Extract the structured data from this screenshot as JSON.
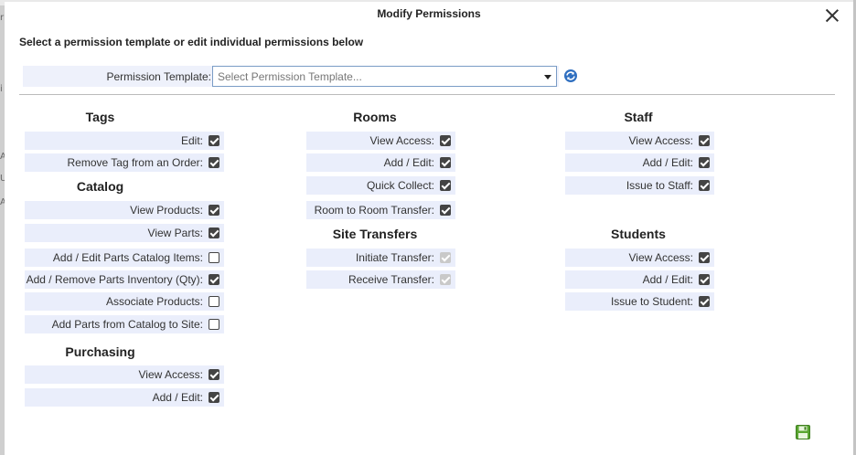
{
  "background": {
    "edge_chars": [
      "r",
      "i",
      "A",
      "U",
      "A"
    ]
  },
  "dialog": {
    "title": "Modify Permissions",
    "instructions": "Select a permission template or edit individual permissions below",
    "template": {
      "label": "Permission Template:",
      "placeholder": "Select Permission Template..."
    },
    "icons": {
      "close": "close-icon",
      "refresh": "refresh-icon",
      "save": "save-icon"
    },
    "colors": {
      "row_bg": "#eaeefb",
      "select_border": "#7a9cc6",
      "refresh_blue": "#2f6fc0",
      "save_green": "#5aa631"
    }
  },
  "sections": {
    "tags": {
      "title": "Tags",
      "items": [
        {
          "label": "Edit:",
          "checked": true
        },
        {
          "label": "Remove Tag from an Order:",
          "checked": true
        }
      ]
    },
    "catalog": {
      "title": "Catalog",
      "items": [
        {
          "label": "View Products:",
          "checked": true
        },
        {
          "label": "View Parts:",
          "checked": true
        },
        {
          "label": "Add / Edit Parts Catalog Items:",
          "checked": false
        },
        {
          "label": "Add / Remove Parts Inventory (Qty):",
          "checked": true
        },
        {
          "label": "Associate Products:",
          "checked": false
        },
        {
          "label": "Add Parts from Catalog to Site:",
          "checked": false
        }
      ]
    },
    "purchasing": {
      "title": "Purchasing",
      "items": [
        {
          "label": "View Access:",
          "checked": true
        },
        {
          "label": "Add / Edit:",
          "checked": true
        }
      ]
    },
    "rooms": {
      "title": "Rooms",
      "items": [
        {
          "label": "View Access:",
          "checked": true
        },
        {
          "label": "Add / Edit:",
          "checked": true
        },
        {
          "label": "Quick Collect:",
          "checked": true
        },
        {
          "label": "Room to Room Transfer:",
          "checked": true
        }
      ]
    },
    "site_transfers": {
      "title": "Site Transfers",
      "items": [
        {
          "label": "Initiate Transfer:",
          "checked": true,
          "disabled": true
        },
        {
          "label": "Receive Transfer:",
          "checked": true,
          "disabled": true
        }
      ]
    },
    "staff": {
      "title": "Staff",
      "items": [
        {
          "label": "View Access:",
          "checked": true
        },
        {
          "label": "Add / Edit:",
          "checked": true
        },
        {
          "label": "Issue to Staff:",
          "checked": true
        }
      ]
    },
    "students": {
      "title": "Students",
      "items": [
        {
          "label": "View Access:",
          "checked": true
        },
        {
          "label": "Add / Edit:",
          "checked": true
        },
        {
          "label": "Issue to Student:",
          "checked": true
        }
      ]
    }
  }
}
